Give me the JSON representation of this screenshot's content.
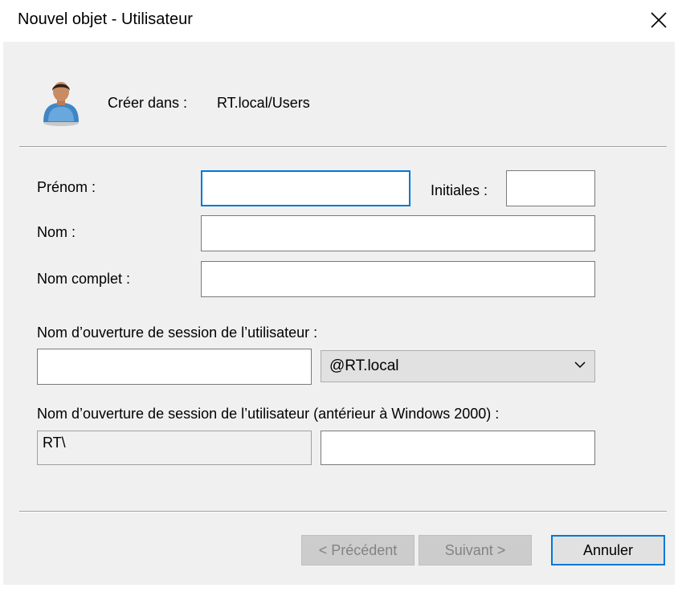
{
  "window": {
    "title": "Nouvel objet - Utilisateur",
    "close_icon": "close-icon"
  },
  "header": {
    "icon": "user-icon",
    "create_in_label": "Créer dans :",
    "create_in_value": "RT.local/Users"
  },
  "form": {
    "first_name": {
      "label": "Prénom :",
      "value": ""
    },
    "initials": {
      "label": "Initiales :",
      "value": ""
    },
    "last_name": {
      "label": "Nom :",
      "value": ""
    },
    "full_name": {
      "label": "Nom complet :",
      "value": ""
    },
    "logon_name": {
      "label": "Nom d’ouverture de session de l’utilisateur :",
      "value": "",
      "domain_selected": "@RT.local"
    },
    "pre2000_logon": {
      "label": "Nom d’ouverture de session de l’utilisateur (antérieur à Windows 2000) :",
      "domain_prefix": "RT\\",
      "value": ""
    }
  },
  "buttons": {
    "previous": "< Précédent",
    "next": "Suivant >",
    "cancel": "Annuler"
  },
  "colors": {
    "dialog_background": "#f0f0f0",
    "focus_accent": "#0078d7",
    "disabled_text": "#838383"
  }
}
